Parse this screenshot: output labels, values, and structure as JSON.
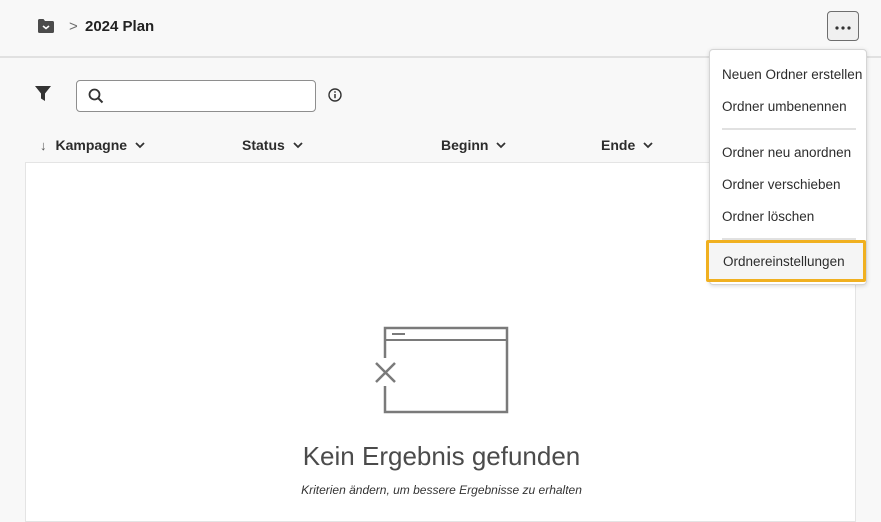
{
  "header": {
    "folder_icon": "folder-icon",
    "separator": ">",
    "title": "2024 Plan",
    "more_icon": "ellipsis-icon"
  },
  "toolbar": {
    "filter_icon": "filter-icon",
    "search_icon": "search-icon",
    "search_value": "",
    "info_icon": "info-icon"
  },
  "columns": [
    {
      "label": "Kampagne",
      "sort": "descending"
    },
    {
      "label": "Status"
    },
    {
      "label": "Beginn"
    },
    {
      "label": "Ende"
    }
  ],
  "empty_state": {
    "title": "Kein Ergebnis gefunden",
    "subtitle": "Kriterien ändern, um bessere Ergebnisse zu erhalten"
  },
  "menu": {
    "items": [
      {
        "label": "Neuen Ordner erstellen"
      },
      {
        "label": "Ordner umbenennen"
      },
      {
        "label": "Ordner neu anordnen"
      },
      {
        "label": "Ordner verschieben"
      },
      {
        "label": "Ordner löschen"
      },
      {
        "label": "Ordnereinstellungen",
        "highlighted": true
      }
    ],
    "highlight_color": "#f0b020"
  }
}
